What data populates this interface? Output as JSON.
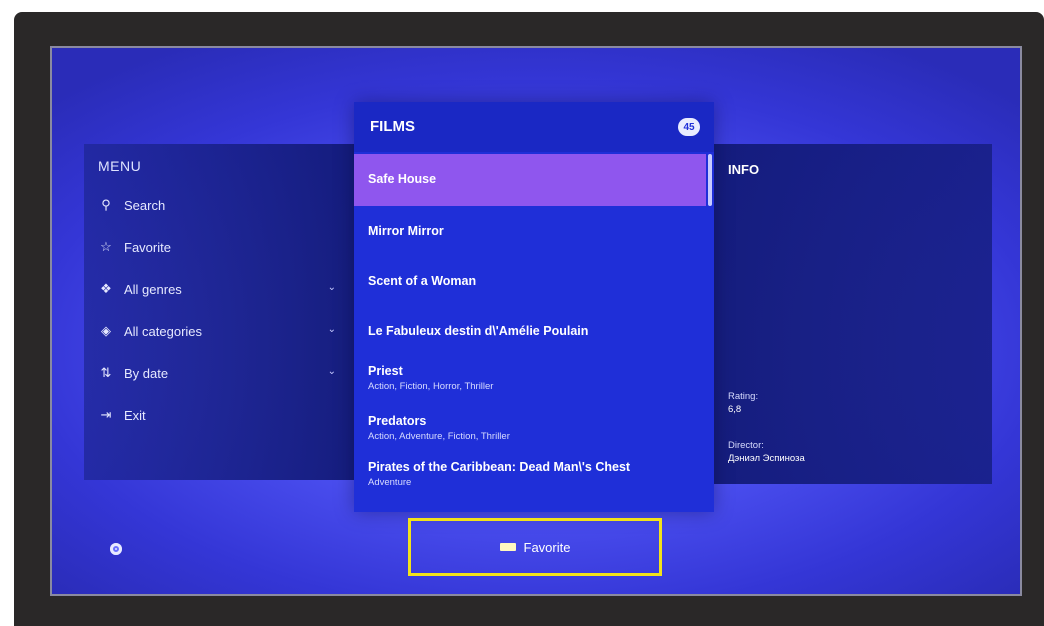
{
  "menu": {
    "title": "MENU",
    "items": [
      {
        "label": "Search",
        "icon": "search-icon",
        "glyph": "⚲",
        "has_chevron": false
      },
      {
        "label": "Favorite",
        "icon": "star-icon",
        "glyph": "☆",
        "has_chevron": false
      },
      {
        "label": "All genres",
        "icon": "genres-icon",
        "glyph": "❖",
        "has_chevron": true
      },
      {
        "label": "All categories",
        "icon": "categories-icon",
        "glyph": "◈",
        "has_chevron": true
      },
      {
        "label": "By date",
        "icon": "sort-icon",
        "glyph": "⇅",
        "has_chevron": true
      },
      {
        "label": "Exit",
        "icon": "exit-icon",
        "glyph": "⇥",
        "has_chevron": false
      }
    ],
    "chevron_glyph": "⌄"
  },
  "films": {
    "title": "FILMS",
    "count": "45",
    "items": [
      {
        "title": "Safe House",
        "genres": ""
      },
      {
        "title": "Mirror Mirror",
        "genres": ""
      },
      {
        "title": "Scent of a Woman",
        "genres": ""
      },
      {
        "title": "Le Fabuleux destin d\\'Amélie Poulain",
        "genres": ""
      },
      {
        "title": "Priest",
        "genres": "Action, Fiction, Horror, Thriller"
      },
      {
        "title": "Predators",
        "genres": "Action, Adventure, Fiction, Thriller"
      },
      {
        "title": "Pirates of the Caribbean: Dead Man\\'s Chest",
        "genres": "Adventure"
      }
    ]
  },
  "info": {
    "title": "INFO",
    "rating_label": "Rating:",
    "rating_value": "6,8",
    "director_label": "Director:",
    "director_value": "Дэниэл Эспиноза"
  },
  "bottom": {
    "favorite_label": "Favorite",
    "highlight_color": "#f2e21a",
    "selected_color": "#8f56ee"
  }
}
